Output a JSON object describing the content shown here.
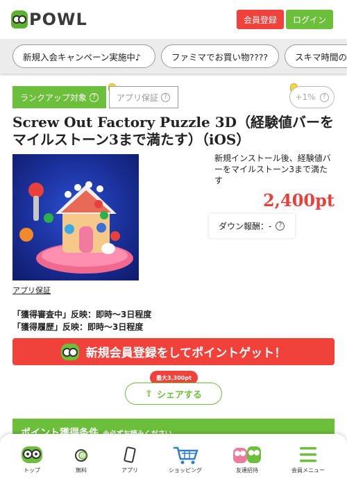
{
  "header": {
    "logo_text": "POWL",
    "register_label": "会員登録",
    "login_label": "ログイン"
  },
  "campaigns": [
    "新規入会キャンペーン実施中♪",
    "ファミマでお買い物????",
    "スキマ時間の"
  ],
  "tags": {
    "rank_up": "ランクアップ対象",
    "app_guarantee": "アプリ保証",
    "plus_rate": "+1%"
  },
  "offer": {
    "title": "Screw Out Factory Puzzle 3D（経験値バーをマイルストーン3まで満たす）（iOS）",
    "description": "新規インストール後、経験値バーをマイルストーン3まで満たす",
    "points": "2,400pt",
    "down_reward": "ダウン報酬：-",
    "app_guarantee_link": "アプリ保証",
    "reflect_pending": "「獲得審査中」反映：即時～3日程度",
    "reflect_history": "「獲得履歴」反映：即時～3日程度"
  },
  "cta": {
    "label": "新規会員登録をしてポイントゲット！"
  },
  "share": {
    "badge": "最大3,300pt",
    "label": "シェアする"
  },
  "conditions": {
    "title": "ポイント獲得条件",
    "note": "※必ずお読みください"
  },
  "bottom_nav": [
    {
      "label": "トップ",
      "icon": "owl-icon"
    },
    {
      "label": "無料",
      "icon": "coin-icon"
    },
    {
      "label": "アプリ",
      "icon": "phone-icon"
    },
    {
      "label": "ショッピング",
      "icon": "cart-icon"
    },
    {
      "label": "友達招待",
      "icon": "friends-icon"
    },
    {
      "label": "会員メニュー",
      "icon": "menu-icon"
    }
  ],
  "colors": {
    "brand_green": "#6cbf3a",
    "accent_red": "#f0413a",
    "points_red": "#e8413b"
  }
}
